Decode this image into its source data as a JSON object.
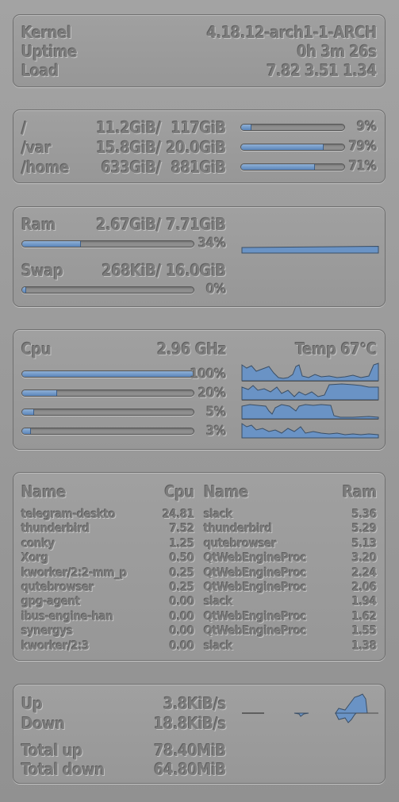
{
  "system": {
    "kernel_label": "Kernel",
    "kernel_value": "4.18.12-arch1-1-ARCH",
    "uptime_label": "Uptime",
    "uptime_value": "0h 3m 26s",
    "load_label": "Load",
    "load_value": "7.82 3.51 1.34"
  },
  "disks": [
    {
      "mount": "/",
      "used": "11.2GiB/",
      "total": "117GiB",
      "percent_label": "9%",
      "fraction": 0.09
    },
    {
      "mount": "/var",
      "used": "15.8GiB/",
      "total": "20.0GiB",
      "percent_label": "79%",
      "fraction": 0.79
    },
    {
      "mount": "/home",
      "used": "633GiB/",
      "total": "881GiB",
      "percent_label": "71%",
      "fraction": 0.71
    }
  ],
  "memory": {
    "ram_label": "Ram",
    "ram_used": "2.67GiB/",
    "ram_total": "7.71GiB",
    "ram_percent": "34%",
    "ram_fraction": 0.34,
    "swap_label": "Swap",
    "swap_used": "268KiB/",
    "swap_total": "16.0GiB",
    "swap_percent": "0%",
    "swap_fraction": 0.0
  },
  "cpu": {
    "label": "Cpu",
    "freq": "2.96 GHz",
    "temp": "Temp 67°C",
    "cores": [
      {
        "percent": "100%",
        "fraction": 1.0
      },
      {
        "percent": "20%",
        "fraction": 0.2
      },
      {
        "percent": "5%",
        "fraction": 0.05
      },
      {
        "percent": "3%",
        "fraction": 0.03
      }
    ]
  },
  "processes": {
    "cpu_header_name": "Name",
    "cpu_header_value": "Cpu",
    "ram_header_name": "Name",
    "ram_header_value": "Ram",
    "rows": [
      {
        "cpu_name": "telegram-deskto",
        "cpu_value": "24.81",
        "ram_name": "slack",
        "ram_value": "5.36"
      },
      {
        "cpu_name": "thunderbird",
        "cpu_value": "7.52",
        "ram_name": "thunderbird",
        "ram_value": "5.29"
      },
      {
        "cpu_name": "conky",
        "cpu_value": "1.25",
        "ram_name": "qutebrowser",
        "ram_value": "5.13"
      },
      {
        "cpu_name": "Xorg",
        "cpu_value": "0.50",
        "ram_name": "QtWebEngineProc",
        "ram_value": "3.20"
      },
      {
        "cpu_name": "kworker/2:2-mm_p",
        "cpu_value": "0.25",
        "ram_name": "QtWebEngineProc",
        "ram_value": "2.24"
      },
      {
        "cpu_name": "qutebrowser",
        "cpu_value": "0.25",
        "ram_name": "QtWebEngineProc",
        "ram_value": "2.06"
      },
      {
        "cpu_name": "gpg-agent",
        "cpu_value": "0.00",
        "ram_name": "slack",
        "ram_value": "1.94"
      },
      {
        "cpu_name": "ibus-engine-han",
        "cpu_value": "0.00",
        "ram_name": "QtWebEngineProc",
        "ram_value": "1.62"
      },
      {
        "cpu_name": "synergys",
        "cpu_value": "0.00",
        "ram_name": "QtWebEngineProc",
        "ram_value": "1.55"
      },
      {
        "cpu_name": "kworker/2:3",
        "cpu_value": "0.00",
        "ram_name": "slack",
        "ram_value": "1.38"
      }
    ]
  },
  "network": {
    "up_label": "Up",
    "up_value": "3.8KiB/s",
    "down_label": "Down",
    "down_value": "18.8KiB/s",
    "total_up_label": "Total up",
    "total_up_value": "78.40MiB",
    "total_down_label": "Total down",
    "total_down_value": "64.80MiB"
  },
  "colors": {
    "fill": "#6a93c5",
    "text": "#7d7d7d"
  }
}
